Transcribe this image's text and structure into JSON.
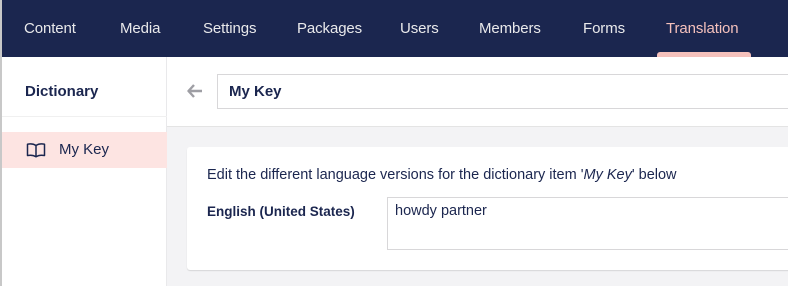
{
  "nav": {
    "items": [
      {
        "label": "Content"
      },
      {
        "label": "Media"
      },
      {
        "label": "Settings"
      },
      {
        "label": "Packages"
      },
      {
        "label": "Users"
      },
      {
        "label": "Members"
      },
      {
        "label": "Forms"
      },
      {
        "label": "Translation",
        "active": true
      }
    ]
  },
  "sidebar": {
    "title": "Dictionary",
    "items": [
      {
        "label": "My Key",
        "icon": "book-icon",
        "selected": true
      }
    ]
  },
  "editor": {
    "name_value": "My Key",
    "description_prefix": "Edit the different language versions for the dictionary item '",
    "description_item": "My Key",
    "description_suffix": "' below",
    "languages": [
      {
        "label": "English (United States)",
        "value": "howdy partner"
      }
    ]
  },
  "colors": {
    "header_bg": "#1b264f",
    "accent": "#f5c1bc",
    "selected_bg": "#fde4e2",
    "text": "#1b264f"
  }
}
